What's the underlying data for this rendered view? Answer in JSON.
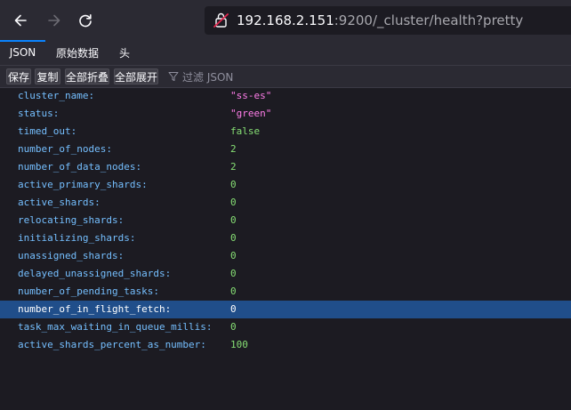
{
  "browser": {
    "url_host": "192.168.2.151",
    "url_rest": ":9200/_cluster/health?pretty"
  },
  "tabs": [
    {
      "label": "JSON",
      "active": true
    },
    {
      "label": "原始数据",
      "active": false
    },
    {
      "label": "头",
      "active": false
    }
  ],
  "toolbar": {
    "save_label": "保存",
    "copy_label": "复制",
    "collapse_all_label": "全部折叠",
    "expand_all_label": "全部展开",
    "filter_placeholder": "过滤 JSON"
  },
  "json_rows": [
    {
      "key": "cluster_name:",
      "value": "\"ss-es\"",
      "type": "string"
    },
    {
      "key": "status:",
      "value": "\"green\"",
      "type": "string"
    },
    {
      "key": "timed_out:",
      "value": "false",
      "type": "bool"
    },
    {
      "key": "number_of_nodes:",
      "value": "2",
      "type": "number"
    },
    {
      "key": "number_of_data_nodes:",
      "value": "2",
      "type": "number"
    },
    {
      "key": "active_primary_shards:",
      "value": "0",
      "type": "number"
    },
    {
      "key": "active_shards:",
      "value": "0",
      "type": "number"
    },
    {
      "key": "relocating_shards:",
      "value": "0",
      "type": "number"
    },
    {
      "key": "initializing_shards:",
      "value": "0",
      "type": "number"
    },
    {
      "key": "unassigned_shards:",
      "value": "0",
      "type": "number"
    },
    {
      "key": "delayed_unassigned_shards:",
      "value": "0",
      "type": "number"
    },
    {
      "key": "number_of_pending_tasks:",
      "value": "0",
      "type": "number"
    },
    {
      "key": "number_of_in_flight_fetch:",
      "value": "0",
      "type": "number",
      "selected": true
    },
    {
      "key": "task_max_waiting_in_queue_millis:",
      "value": "0",
      "type": "number"
    },
    {
      "key": "active_shards_percent_as_number:",
      "value": "100",
      "type": "number"
    }
  ],
  "colors": {
    "key": "#75bfff",
    "string": "#ff7de9",
    "literal": "#86de74",
    "selected_row": "#204e8a",
    "accent": "#0a84ff"
  }
}
